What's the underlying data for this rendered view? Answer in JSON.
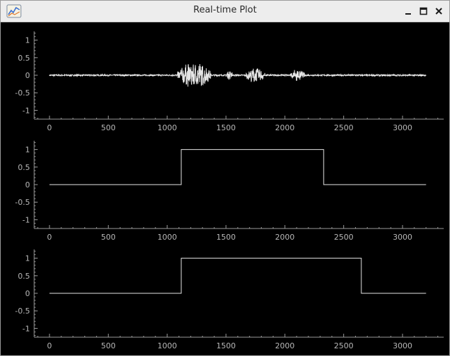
{
  "window": {
    "title": "Real-time Plot",
    "app_icon": "plot-app-icon",
    "controls": [
      "minimize-icon",
      "maximize-icon",
      "close-icon"
    ]
  },
  "colors": {
    "titlebar_bg": "#ededed",
    "plot_bg": "#000000",
    "axis": "#9a9a9a",
    "trace": "#e6e6e6"
  },
  "chart_data": [
    {
      "type": "line",
      "title": "",
      "xlabel": "",
      "ylabel": "",
      "xlim": [
        -130,
        3350
      ],
      "ylim": [
        -1.25,
        1.25
      ],
      "x_ticks": [
        0,
        500,
        1000,
        1500,
        2000,
        2500,
        3000
      ],
      "x_tick_labels": [
        "0",
        "500",
        "1000",
        "1500",
        "2000",
        "2500",
        "3000"
      ],
      "y_ticks": [
        1,
        0.5,
        0,
        -0.5,
        -1
      ],
      "y_tick_labels": [
        "1",
        "0.5",
        "0",
        "-0.5",
        "-1"
      ],
      "grid": false,
      "series": [
        {
          "kind": "waveform",
          "x_range": [
            0,
            3200
          ],
          "noise_amplitude": 0.02,
          "bursts": [
            {
              "x_start": 1090,
              "x_end": 1370,
              "amplitude": 0.42
            },
            {
              "x_start": 1500,
              "x_end": 1560,
              "amplitude": 0.15
            },
            {
              "x_start": 1670,
              "x_end": 1830,
              "amplitude": 0.25
            },
            {
              "x_start": 2050,
              "x_end": 2170,
              "amplitude": 0.18
            }
          ]
        }
      ]
    },
    {
      "type": "line",
      "title": "",
      "xlabel": "",
      "ylabel": "",
      "xlim": [
        -130,
        3350
      ],
      "ylim": [
        -1.25,
        1.25
      ],
      "x_ticks": [
        0,
        500,
        1000,
        1500,
        2000,
        2500,
        3000
      ],
      "x_tick_labels": [
        "0",
        "500",
        "1000",
        "1500",
        "2000",
        "2500",
        "3000"
      ],
      "y_ticks": [
        1,
        0.5,
        0,
        -0.5,
        -1
      ],
      "y_tick_labels": [
        "1",
        "0.5",
        "0",
        "-0.5",
        "-1"
      ],
      "grid": false,
      "series": [
        {
          "kind": "step",
          "x": [
            0,
            1120,
            1120,
            2330,
            2330,
            3200
          ],
          "y": [
            0,
            0,
            1,
            1,
            0,
            0
          ]
        }
      ]
    },
    {
      "type": "line",
      "title": "",
      "xlabel": "",
      "ylabel": "",
      "xlim": [
        -130,
        3350
      ],
      "ylim": [
        -1.25,
        1.25
      ],
      "x_ticks": [
        0,
        500,
        1000,
        1500,
        2000,
        2500,
        3000
      ],
      "x_tick_labels": [
        "0",
        "500",
        "1000",
        "1500",
        "2000",
        "2500",
        "3000"
      ],
      "y_ticks": [
        1,
        0.5,
        0,
        -0.5,
        -1
      ],
      "y_tick_labels": [
        "1",
        "0.5",
        "0",
        "-0.5",
        "-1"
      ],
      "grid": false,
      "series": [
        {
          "kind": "step",
          "x": [
            0,
            1120,
            1120,
            2650,
            2650,
            3200
          ],
          "y": [
            0,
            0,
            1,
            1,
            0,
            0
          ]
        }
      ]
    }
  ]
}
